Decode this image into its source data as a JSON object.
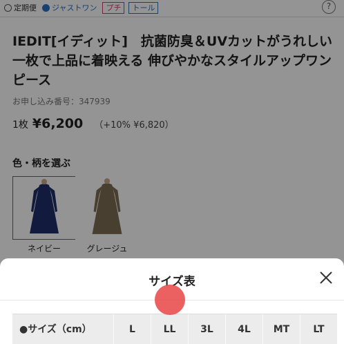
{
  "badges": {
    "regular": "定期便",
    "just_one": "ジャストワン",
    "tag_petit": "プチ",
    "tag_tall": "トール",
    "help": "?"
  },
  "product": {
    "title": "IEDIT[イディット]　抗菌防臭＆UVカットがうれしい一枚で上品に着映える 伸びやかなスタイルアップワンピース",
    "order_number": "お申し込み番号：347939",
    "quantity": "1枚",
    "price": "¥6,200",
    "price_tax": "（+10% ¥6,820）"
  },
  "colors": {
    "heading": "色・柄を選ぶ",
    "options": [
      {
        "label": "ネイビー",
        "selected": true,
        "color": "#1f2f6b"
      },
      {
        "label": "グレージュ",
        "selected": false,
        "color": "#7d6d55"
      }
    ]
  },
  "size_sheet": {
    "title": "サイズ表",
    "header_label": "●サイズ（cm）",
    "sizes": [
      "L",
      "LL",
      "3L",
      "4L",
      "MT",
      "LT"
    ]
  },
  "touch_indicator_color": "#e84a4a"
}
